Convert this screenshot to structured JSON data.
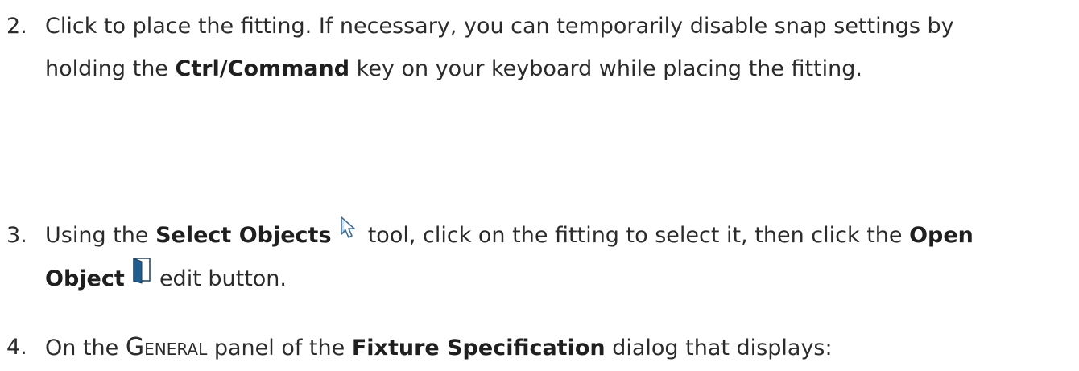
{
  "steps": [
    {
      "number": "2.",
      "line1": "Click to place the fitting. If necessary, you can temporarily disable snap settings by",
      "line2_before": "holding the ",
      "line2_bold": "Ctrl/Command",
      "line2_after": " key on your keyboard while placing the fitting."
    },
    {
      "number": "3.",
      "before_bold1": "Using the ",
      "bold1": "Select Objects",
      "icon1": "select-objects-arrow-icon",
      "mid_text": " tool, click on the fitting to select it, then click the ",
      "bold2_part1": "Open",
      "bold2_part2": "Object",
      "icon2": "open-object-door-icon",
      "after_text": " edit button."
    },
    {
      "number": "4.",
      "before_panel": "On the ",
      "panel_first_letter": "G",
      "panel_rest": "ENERAL",
      "after_panel": " panel of the ",
      "bold": "Fixture Specification",
      "after_bold": " dialog that displays:"
    }
  ],
  "colors": {
    "text": "#2b2b2b",
    "icon_blue": "#1f5d8f"
  }
}
